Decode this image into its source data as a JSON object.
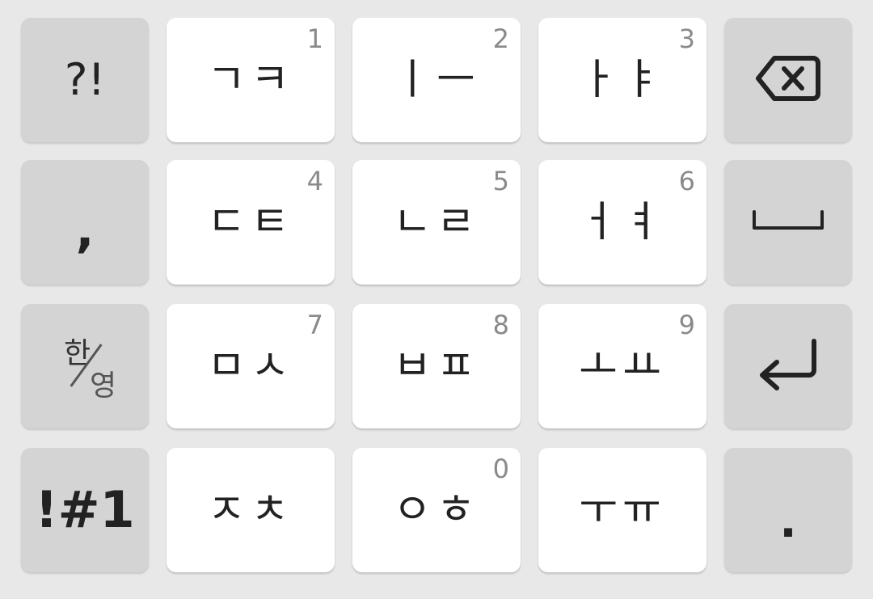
{
  "keyboard": {
    "row1": {
      "left": "?!",
      "k1": {
        "letters": "ㄱㅋ",
        "num": "1"
      },
      "k2": {
        "letters": "ㅣㅡ",
        "num": "2"
      },
      "k3": {
        "letters": "ㅏㅑ",
        "num": "3"
      },
      "right_icon": "backspace-icon"
    },
    "row2": {
      "left": ",",
      "k4": {
        "letters": "ㄷㅌ",
        "num": "4"
      },
      "k5": {
        "letters": "ㄴㄹ",
        "num": "5"
      },
      "k6": {
        "letters": "ㅓㅕ",
        "num": "6"
      },
      "right_icon": "space-icon"
    },
    "row3": {
      "left": {
        "han": "한",
        "yeong": "영"
      },
      "k7": {
        "letters": "ㅁㅅ",
        "num": "7"
      },
      "k8": {
        "letters": "ㅂㅍ",
        "num": "8"
      },
      "k9": {
        "letters": "ㅗㅛ",
        "num": "9"
      },
      "right_icon": "enter-icon"
    },
    "row4": {
      "left": "!#1",
      "k_star": {
        "letters": "ㅈㅊ"
      },
      "k0": {
        "letters": "ㅇㅎ",
        "num": "0"
      },
      "k_hash": {
        "letters": "ㅜㅠ"
      },
      "right": "."
    }
  },
  "colors": {
    "background": "#e8e8e8",
    "white_key": "#ffffff",
    "gray_key": "#d4d4d4",
    "text": "#222222",
    "number_hint": "#8a8a8a"
  }
}
